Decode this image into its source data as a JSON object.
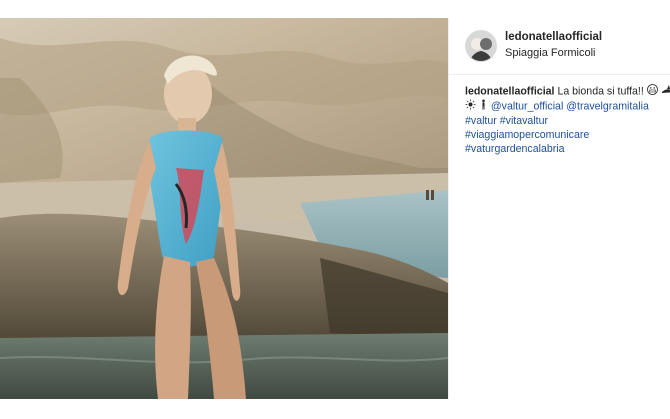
{
  "post": {
    "username": "ledonatellaofficial",
    "location": "Spiaggia Formicoli",
    "caption": {
      "username": "ledonatellaofficial",
      "text": "La bionda si tuffa!!",
      "emojis_line1": [
        "grimace-face-emoji",
        "shark-emoji"
      ],
      "emojis_line2": [
        "sun-emoji",
        "man-standing-emoji"
      ],
      "mentions": [
        "@valtur_official",
        "@travelgramitalia"
      ],
      "hashtags_line3": [
        "#valtur",
        "#vitavaltur"
      ],
      "hashtags_line4": "#viaggiamopercomunicare",
      "hashtags_line5": "#vaturgardencalabria"
    }
  },
  "colors": {
    "link": "#1f4f9a",
    "text": "#262626",
    "divider": "#efefef"
  }
}
